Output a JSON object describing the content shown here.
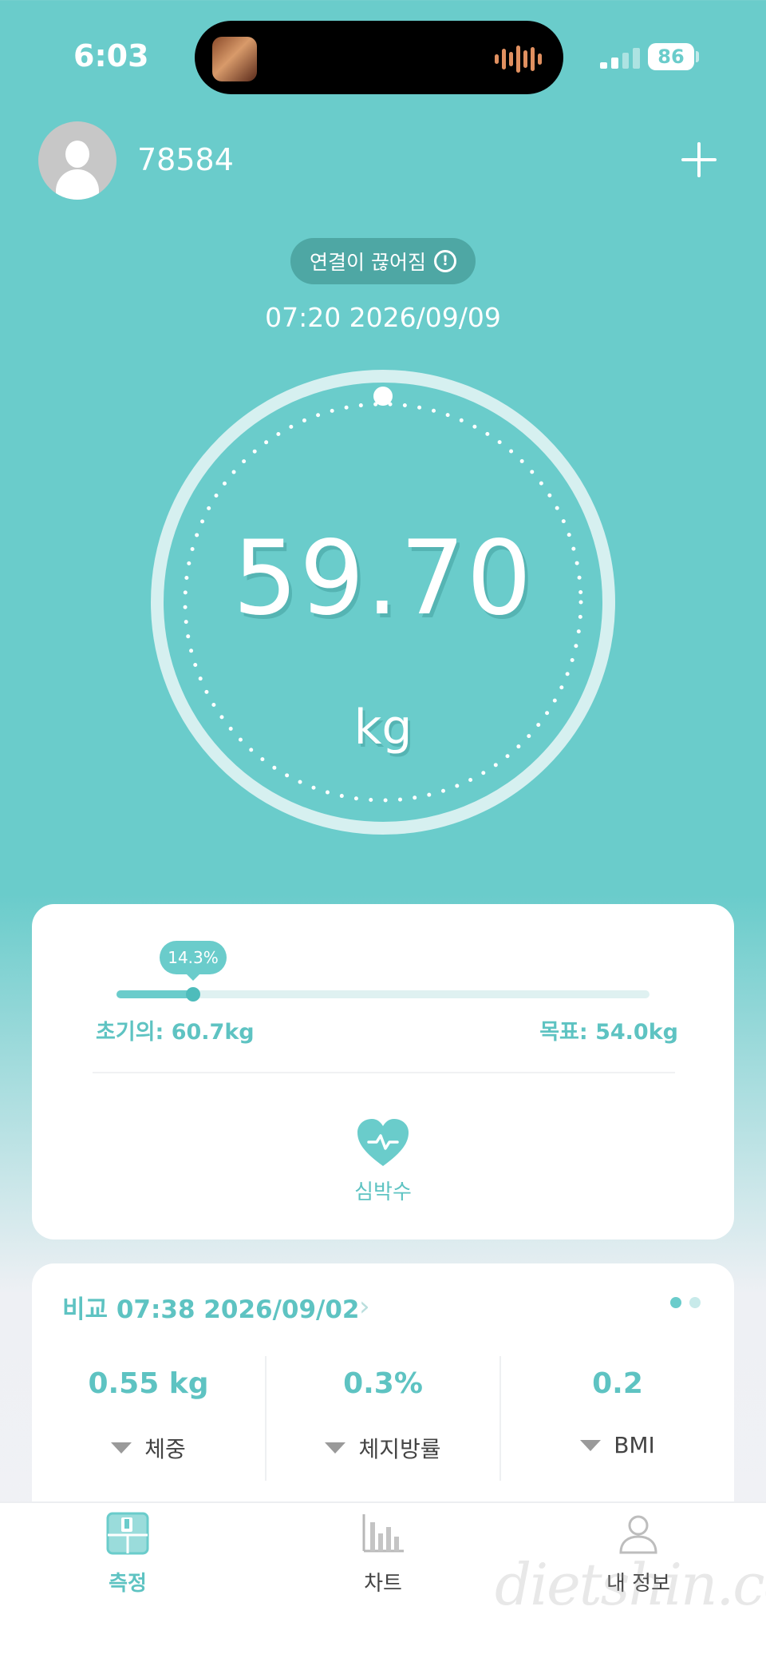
{
  "status_bar": {
    "time": "6:03",
    "battery": "86"
  },
  "header": {
    "user_id": "78584"
  },
  "connection": {
    "status_text": "연결이 끊어짐"
  },
  "measurement": {
    "datetime": "07:20 2026/09/09",
    "weight": "59.70",
    "unit": "kg"
  },
  "goal_card": {
    "progress_label": "14.3%",
    "progress": 0.143,
    "initial_label": "초기의: 60.7kg",
    "goal_label": "목표: 54.0kg",
    "heart_rate_label": "심박수"
  },
  "compare": {
    "title": "비교 07:38 2026/09/02",
    "stats": [
      {
        "value": "0.55 kg",
        "label": "체중"
      },
      {
        "value": "0.3%",
        "label": "체지방률"
      },
      {
        "value": "0.2",
        "label": "BMI"
      }
    ]
  },
  "tabs": [
    {
      "label": "측정",
      "active": true
    },
    {
      "label": "차트",
      "active": false
    },
    {
      "label": "내 정보",
      "active": false
    }
  ],
  "watermark": "dietshin.com",
  "colors": {
    "accent": "#6acccb",
    "accent_dark": "#4ea7a4",
    "label": "#5ec3c2"
  }
}
